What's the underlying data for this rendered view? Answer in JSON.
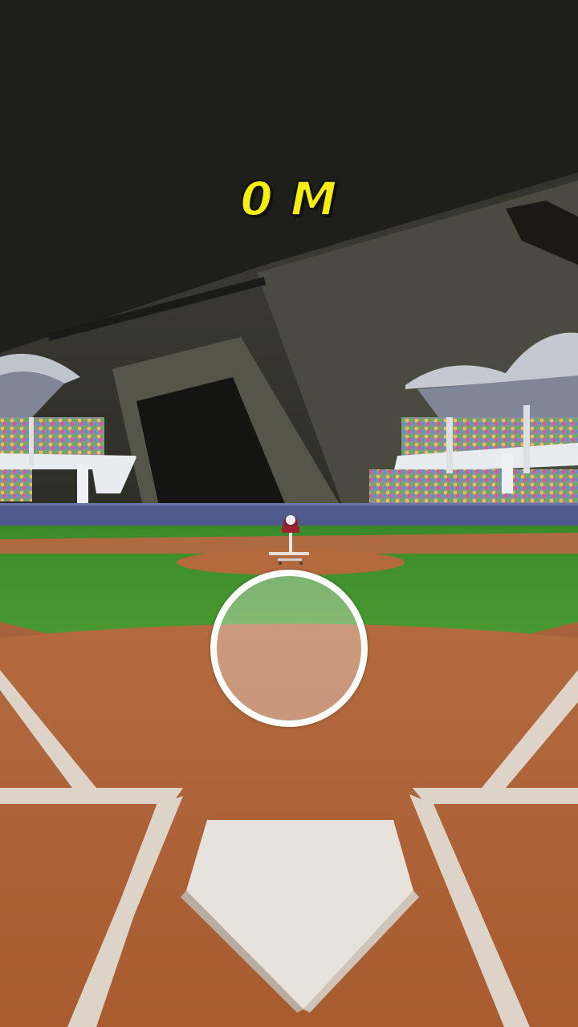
{
  "hud": {
    "distance_text": "0 M"
  },
  "colors": {
    "distance_text": "#f6ee10",
    "infield_dirt": "#b76a3b",
    "outfield_grass": "#3f8f2c",
    "outfield_wall": "#4d5a8a",
    "reticle": "#ffffff"
  },
  "icons": {
    "pitcher": "pitching-machine-icon",
    "reticle": "aim-reticle-icon",
    "home_plate": "home-plate-icon"
  }
}
